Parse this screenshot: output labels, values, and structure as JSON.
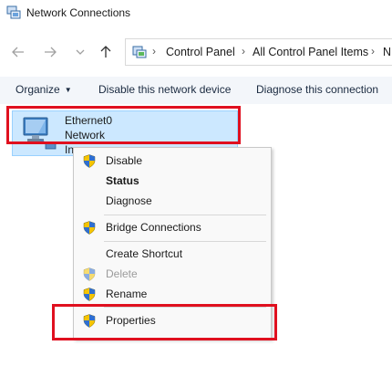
{
  "window": {
    "title": "Network Connections"
  },
  "nav": {
    "back_icon": "back-arrow-icon",
    "forward_icon": "forward-arrow-icon",
    "up_icon": "up-arrow-icon",
    "breadcrumbs": [
      "Control Panel",
      "All Control Panel Items",
      "N"
    ]
  },
  "commands": {
    "organize": "Organize",
    "disable": "Disable this network device",
    "diagnose": "Diagnose this connection"
  },
  "network_item": {
    "name": "Ethernet0",
    "status": "Network",
    "device": "In"
  },
  "context_menu": {
    "items": [
      {
        "label": "Disable",
        "icon": "shield-icon",
        "bold": false,
        "disabled": false
      },
      {
        "label": "Status",
        "icon": "",
        "bold": true,
        "disabled": false
      },
      {
        "label": "Diagnose",
        "icon": "",
        "bold": false,
        "disabled": false
      },
      {
        "label": "Bridge Connections",
        "icon": "shield-icon",
        "bold": false,
        "disabled": false
      },
      {
        "label": "Create Shortcut",
        "icon": "",
        "bold": false,
        "disabled": false
      },
      {
        "label": "Delete",
        "icon": "shield-icon",
        "bold": false,
        "disabled": true
      },
      {
        "label": "Rename",
        "icon": "shield-icon",
        "bold": false,
        "disabled": false
      },
      {
        "label": "Properties",
        "icon": "shield-icon",
        "bold": false,
        "disabled": false
      }
    ]
  },
  "colors": {
    "selection": "#cce8ff",
    "annotation": "#e0101f",
    "shield_blue": "#2f6fd1",
    "shield_yellow": "#f5c400"
  }
}
